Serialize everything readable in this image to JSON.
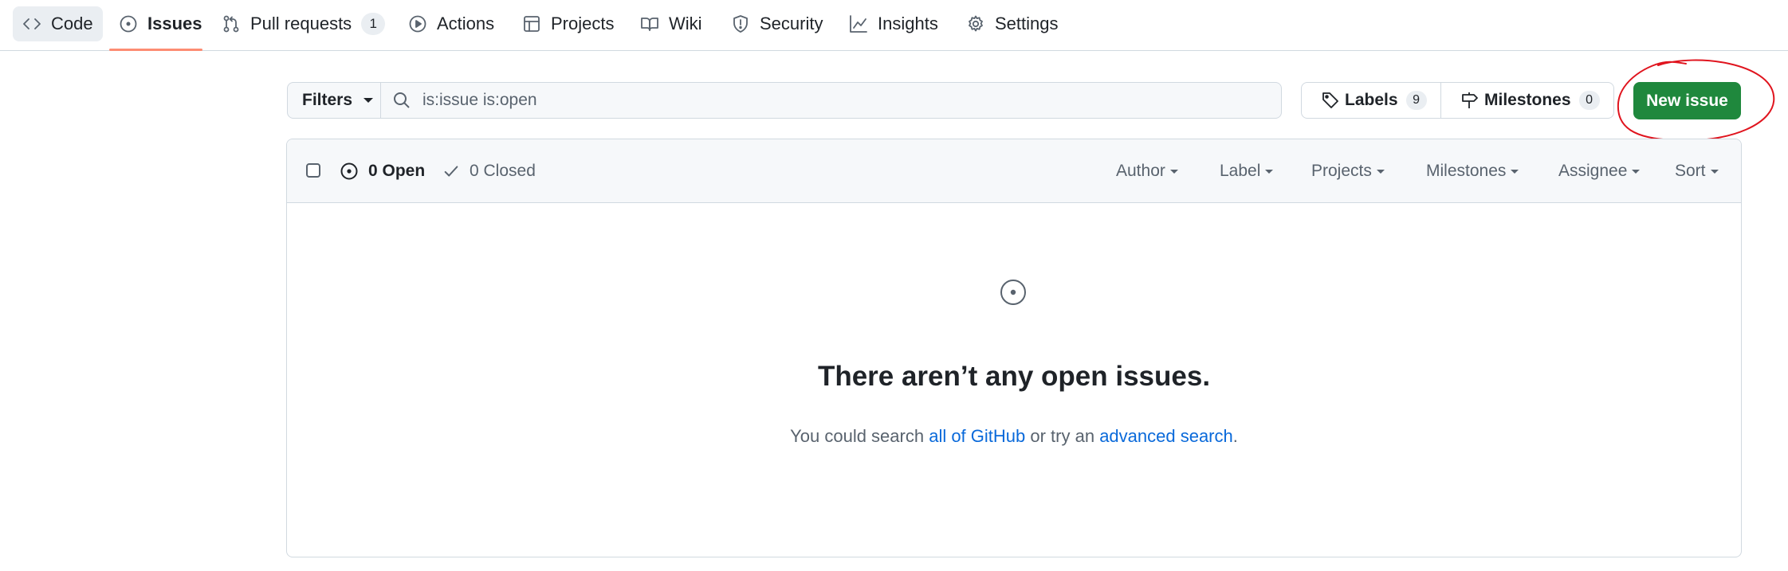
{
  "nav": {
    "items": [
      {
        "label": "Code",
        "icon": "code-icon"
      },
      {
        "label": "Issues",
        "icon": "issue-opened-icon",
        "selected": true
      },
      {
        "label": "Pull requests",
        "icon": "git-pull-request-icon",
        "count": "1"
      },
      {
        "label": "Actions",
        "icon": "play-icon"
      },
      {
        "label": "Projects",
        "icon": "table-icon"
      },
      {
        "label": "Wiki",
        "icon": "book-icon"
      },
      {
        "label": "Security",
        "icon": "shield-icon"
      },
      {
        "label": "Insights",
        "icon": "graph-icon"
      },
      {
        "label": "Settings",
        "icon": "gear-icon"
      }
    ]
  },
  "toolbar": {
    "filters_label": "Filters",
    "search_value": "is:issue is:open",
    "labels_label": "Labels",
    "labels_count": "9",
    "milestones_label": "Milestones",
    "milestones_count": "0",
    "new_issue_label": "New issue"
  },
  "list_header": {
    "open_label": "0 Open",
    "closed_label": "0 Closed",
    "filters": [
      "Author",
      "Label",
      "Projects",
      "Milestones",
      "Assignee",
      "Sort"
    ]
  },
  "blankslate": {
    "title": "There aren’t any open issues.",
    "desc_prefix": "You could search ",
    "link1": "all of GitHub",
    "desc_middle": " or try an ",
    "link2": "advanced search",
    "desc_suffix": "."
  },
  "colors": {
    "accent_green": "#1f883d",
    "link_blue": "#0969da",
    "nav_underline": "#fd8c73",
    "annotation_red": "#e0141e"
  }
}
